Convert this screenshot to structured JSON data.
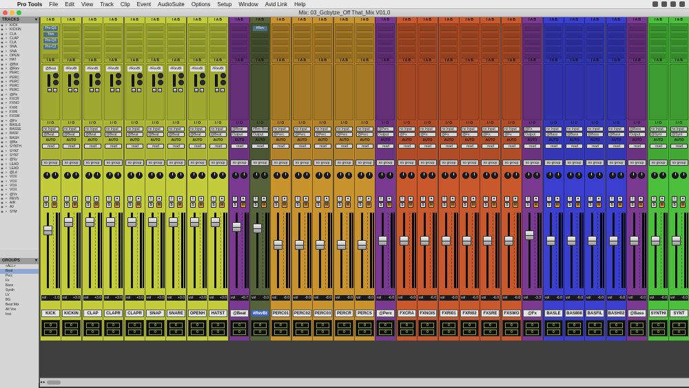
{
  "menubar": {
    "apple": "",
    "items": [
      "Pro Tools",
      "File",
      "Edit",
      "View",
      "Track",
      "Clip",
      "Event",
      "AudioSuite",
      "Options",
      "Setup",
      "Window",
      "Avid Link",
      "Help"
    ]
  },
  "window": {
    "title": "Mix: 03_Gcbytze_Off That_Mix V01,0"
  },
  "tracks_panel": {
    "title": "TRACKS",
    "items": [
      "KICK",
      "KICKIN",
      "CLA",
      "CLAP",
      "CLA",
      "SNA",
      "SNA",
      "OPEN",
      "HAT",
      "@Bst",
      "@Rev",
      "PERC",
      "PERC",
      "PERC",
      "PERC",
      "PERC",
      "@Pe",
      "FXCR",
      "FXNO",
      "FXRI",
      "FXRI",
      "FXSW",
      "@Fx",
      "BASLE",
      "BASSE",
      "BASF",
      "BASH",
      "@Ba",
      "SYNTH",
      "SYNT",
      "SYNT",
      "@Sy",
      "LEAD",
      "LEAD",
      "@Ld",
      "VOX",
      "VOX",
      "VOX",
      "VOX",
      "@Vx",
      "REVS",
      "AIR",
      "AV",
      "STM"
    ]
  },
  "groups_panel": {
    "title": "GROUPS",
    "items": [
      "<ALL>",
      "Beat",
      "Perc",
      "Fx",
      "Bass",
      "Synth",
      "LV",
      "BG",
      "Beat Mix",
      "All Vox",
      "Inst"
    ],
    "selected": 1
  },
  "strips": [
    {
      "name": "KICK",
      "hdr": "I A B",
      "color": "#c3cd3c",
      "inserts": [
        "Pro-Q3",
        "Trim",
        "Pro-Q3",
        "Pro-C2"
      ],
      "send": "@Beat",
      "in": "no input",
      "out": "@Beat",
      "auto": "AUTO",
      "mode": "read",
      "group": "no group",
      "vol": "vol",
      "val": "-1.0"
    },
    {
      "name": "KICKIN",
      "hdr": "I A B",
      "color": "#c3cd3c",
      "inserts": [],
      "send": "#RevBt",
      "in": "no input",
      "out": "@Beat",
      "auto": "AUTO",
      "mode": "read",
      "group": "no group",
      "vol": "vol",
      "val": "+3.0"
    },
    {
      "name": "CLAP",
      "hdr": "I A B",
      "color": "#c3cd3c",
      "inserts": [],
      "send": "#RevBt",
      "in": "no input",
      "out": "@Beat",
      "auto": "AUTO",
      "mode": "read",
      "group": "no group",
      "vol": "vol",
      "val": "+3.0"
    },
    {
      "name": "CLAPR",
      "hdr": "I A B",
      "color": "#c3cd3c",
      "inserts": [],
      "send": "#RevBt",
      "in": "no input",
      "out": "@Beat",
      "auto": "AUTO",
      "mode": "read",
      "group": "no group",
      "vol": "vol",
      "val": "+3.0"
    },
    {
      "name": "CLAPR",
      "hdr": "I A B",
      "color": "#c3cd3c",
      "inserts": [],
      "send": "#RevBt",
      "in": "no input",
      "out": "@Beat",
      "auto": "AUTO",
      "mode": "read",
      "group": "no group",
      "vol": "vol",
      "val": "+3.0"
    },
    {
      "name": "SNAP",
      "hdr": "I A B",
      "color": "#c3cd3c",
      "inserts": [],
      "send": "#RevBt",
      "in": "no input",
      "out": "@Beat",
      "auto": "AUTO",
      "mode": "read",
      "group": "no group",
      "vol": "vol",
      "val": "+3.0"
    },
    {
      "name": "SNARE",
      "hdr": "I A B",
      "color": "#c3cd3c",
      "inserts": [],
      "send": "#RevBt",
      "in": "no input",
      "out": "@Beat",
      "auto": "AUTO",
      "mode": "read",
      "group": "no group",
      "vol": "vol",
      "val": "+3.0"
    },
    {
      "name": "OPENH",
      "hdr": "I A B",
      "color": "#c3cd3c",
      "inserts": [],
      "send": "#RevBt",
      "in": "no input",
      "out": "@Beat",
      "auto": "AUTO",
      "mode": "read",
      "group": "no group",
      "vol": "vol",
      "val": "+3.0"
    },
    {
      "name": "HATST",
      "hdr": "I A B",
      "color": "#c3cd3c",
      "inserts": [],
      "send": "#RevBt",
      "in": "no input",
      "out": "@Beat",
      "auto": "AUTO",
      "mode": "read",
      "group": "no group",
      "vol": "vol",
      "val": "+3.0"
    },
    {
      "name": "@Beat",
      "hdr": "I A B",
      "color": "#7a3a92",
      "inserts": [],
      "send": "",
      "in": "@Beat",
      "out": "Output",
      "auto": "AUTO",
      "mode": "read",
      "group": "no group",
      "vol": "vol",
      "val": "+0.7"
    },
    {
      "name": "#RevBt",
      "hdr": "I A B",
      "color": "#55623a",
      "inserts": [
        "#Rev"
      ],
      "send": "",
      "in": "#Rev Beat",
      "out": "Output",
      "auto": "AUTO",
      "mode": "read",
      "group": "no group",
      "vol": "vol",
      "val": "-0.0",
      "highlight": true
    },
    {
      "name": "PERC01",
      "hdr": "I A B",
      "color": "#c9932e",
      "inserts": [],
      "send": "",
      "in": "no input",
      "out": "@Perc",
      "auto": "AUTO",
      "mode": "read",
      "group": "no group",
      "vol": "vol",
      "val": "-8.0"
    },
    {
      "name": "PERC02",
      "hdr": "I A B",
      "color": "#c9932e",
      "inserts": [],
      "send": "",
      "in": "no input",
      "out": "@Perc",
      "auto": "AUTO",
      "mode": "read",
      "group": "no group",
      "vol": "vol",
      "val": "-8.0"
    },
    {
      "name": "PERC03",
      "hdr": "I A B",
      "color": "#c9932e",
      "inserts": [],
      "send": "",
      "in": "no input",
      "out": "@Perc",
      "auto": "AUTO",
      "mode": "read",
      "group": "no group",
      "vol": "vol",
      "val": "-8.0"
    },
    {
      "name": "PERCR",
      "hdr": "I A B",
      "color": "#c9932e",
      "inserts": [],
      "send": "",
      "in": "no input",
      "out": "@Perc",
      "auto": "AUTO",
      "mode": "read",
      "group": "no group",
      "vol": "vol",
      "val": "-8.0"
    },
    {
      "name": "PERCS",
      "hdr": "I A B",
      "color": "#c9932e",
      "inserts": [],
      "send": "",
      "in": "no input",
      "out": "@Perc",
      "auto": "AUTO",
      "mode": "read",
      "group": "no group",
      "vol": "vol",
      "val": "-8.0"
    },
    {
      "name": "@Perc",
      "hdr": "I A B",
      "color": "#7a3a92",
      "inserts": [],
      "send": "",
      "in": "@Perc",
      "out": "Output",
      "auto": "AUTO",
      "mode": "read",
      "group": "no group",
      "vol": "vol",
      "val": "-6.0"
    },
    {
      "name": "FXCRA",
      "hdr": "I A B",
      "color": "#c9582d",
      "inserts": [],
      "send": "",
      "in": "no input",
      "out": "@Fx",
      "auto": "AUTO",
      "mode": "read",
      "group": "no group",
      "vol": "vol",
      "val": "-6.0"
    },
    {
      "name": "FXNOIS",
      "hdr": "I A B",
      "color": "#c9582d",
      "inserts": [],
      "send": "",
      "in": "no input",
      "out": "@Fx",
      "auto": "AUTO",
      "mode": "read",
      "group": "no group",
      "vol": "vol",
      "val": "-6.0"
    },
    {
      "name": "FXRI01",
      "hdr": "I A B",
      "color": "#c9582d",
      "inserts": [],
      "send": "",
      "in": "no input",
      "out": "@Fx",
      "auto": "AUTO",
      "mode": "read",
      "group": "no group",
      "vol": "vol",
      "val": "-6.0"
    },
    {
      "name": "FXRI02",
      "hdr": "I A B",
      "color": "#c9582d",
      "inserts": [],
      "send": "",
      "in": "no input",
      "out": "@Fx",
      "auto": "AUTO",
      "mode": "read",
      "group": "no group",
      "vol": "vol",
      "val": "-6.0"
    },
    {
      "name": "FXSRE",
      "hdr": "I A B",
      "color": "#c9582d",
      "inserts": [],
      "send": "",
      "in": "no input",
      "out": "@Fx",
      "auto": "AUTO",
      "mode": "read",
      "group": "no group",
      "vol": "vol",
      "val": "-6.0"
    },
    {
      "name": "FXSWO",
      "hdr": "I A B",
      "color": "#c9582d",
      "inserts": [],
      "send": "",
      "in": "no input",
      "out": "@Fx",
      "auto": "AUTO",
      "mode": "read",
      "group": "no group",
      "vol": "vol",
      "val": "-6.0"
    },
    {
      "name": "@Fx",
      "hdr": "I A B",
      "color": "#7a3a92",
      "inserts": [],
      "send": "",
      "in": "@Fx",
      "out": "Output",
      "auto": "AUTO",
      "mode": "read",
      "group": "no group",
      "vol": "vol",
      "val": "-3.3"
    },
    {
      "name": "BASLE",
      "hdr": "I A B",
      "color": "#3b3fcf",
      "inserts": [],
      "send": "",
      "in": "no input",
      "out": "@Bass",
      "auto": "AUTO",
      "mode": "read",
      "group": "no group",
      "vol": "vol",
      "val": "-6.0"
    },
    {
      "name": "BAS808",
      "hdr": "I A B",
      "color": "#3b3fcf",
      "inserts": [],
      "send": "",
      "in": "no input",
      "out": "@Bass",
      "auto": "AUTO",
      "mode": "read",
      "group": "no group",
      "vol": "vol",
      "val": "-6.0"
    },
    {
      "name": "BASFIL",
      "hdr": "I A B",
      "color": "#3b3fcf",
      "inserts": [],
      "send": "",
      "in": "no input",
      "out": "@Bass",
      "auto": "AUTO",
      "mode": "read",
      "group": "no group",
      "vol": "vol",
      "val": "-6.0"
    },
    {
      "name": "BASH02",
      "hdr": "I A B",
      "color": "#3b3fcf",
      "inserts": [],
      "send": "",
      "in": "no input",
      "out": "@Bass",
      "auto": "AUTO",
      "mode": "read",
      "group": "no group",
      "vol": "vol",
      "val": "-6.0"
    },
    {
      "name": "@Bass",
      "hdr": "I A B",
      "color": "#7a3a92",
      "inserts": [],
      "send": "",
      "in": "@Bass",
      "out": "Output",
      "auto": "AUTO",
      "mode": "read",
      "group": "no group",
      "vol": "vol",
      "val": "-6.0"
    },
    {
      "name": "SYNTHI",
      "hdr": "I A B",
      "color": "#4cc03c",
      "inserts": [],
      "send": "",
      "in": "no input",
      "out": "@Synt",
      "auto": "AUTO",
      "mode": "read",
      "group": "no group",
      "vol": "vol",
      "val": "-6.0"
    },
    {
      "name": "SYNT",
      "hdr": "I A B",
      "color": "#4cc03c",
      "inserts": [],
      "send": "",
      "in": "no input",
      "out": "@Synt",
      "auto": "AUTO",
      "mode": "read",
      "group": "no group",
      "vol": "vol",
      "val": "-6.0"
    }
  ]
}
